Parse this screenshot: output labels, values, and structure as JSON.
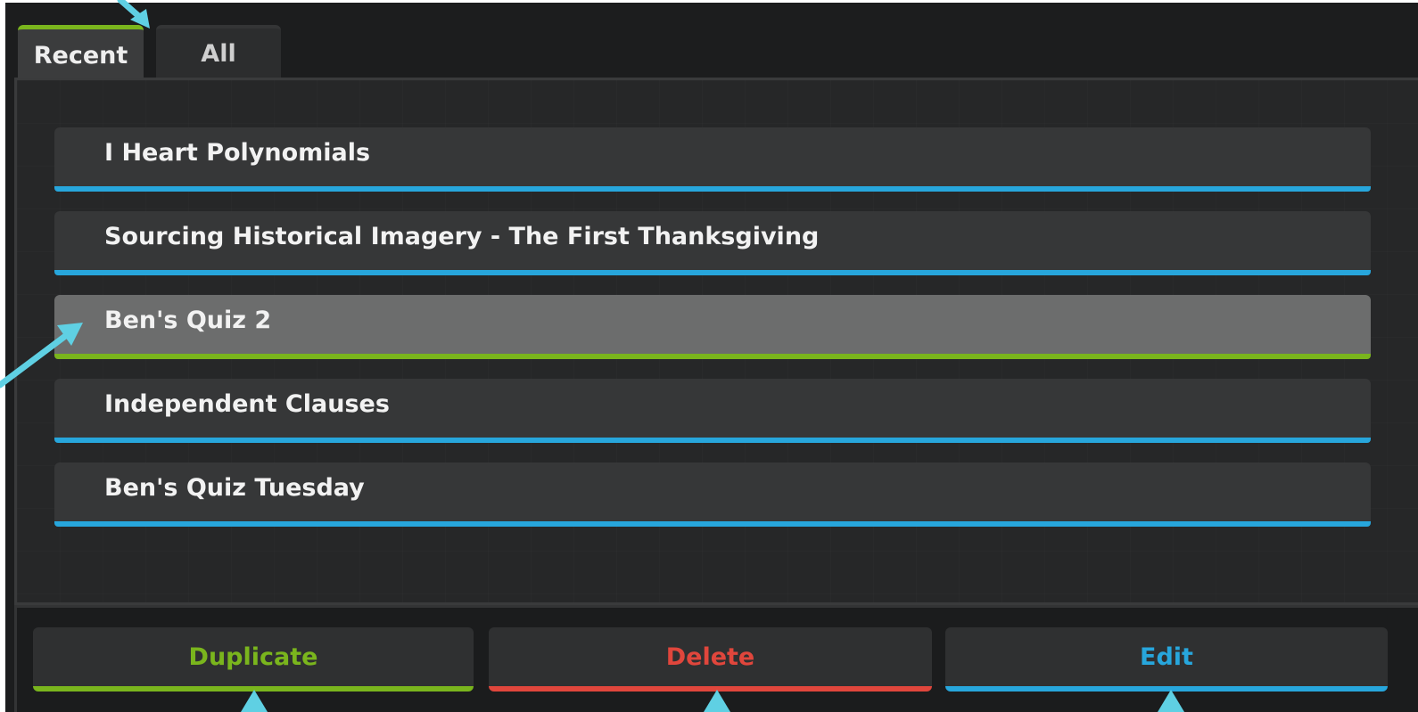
{
  "tabs": [
    {
      "label": "Recent",
      "active": true
    },
    {
      "label": "All",
      "active": false
    }
  ],
  "quizzes": [
    {
      "title": "I Heart Polynomials",
      "selected": false
    },
    {
      "title": "Sourcing Historical Imagery - The First Thanksgiving",
      "selected": false
    },
    {
      "title": "Ben's Quiz 2",
      "selected": true
    },
    {
      "title": "Independent Clauses",
      "selected": false
    },
    {
      "title": "Ben's Quiz Tuesday",
      "selected": false
    }
  ],
  "actions": {
    "duplicate_label": "Duplicate",
    "delete_label": "Delete",
    "edit_label": "Edit"
  },
  "colors": {
    "accent_green": "#7ab51d",
    "accent_blue": "#27a6dc",
    "accent_red": "#e0463c",
    "callout_arrow": "#5fd0e3"
  }
}
